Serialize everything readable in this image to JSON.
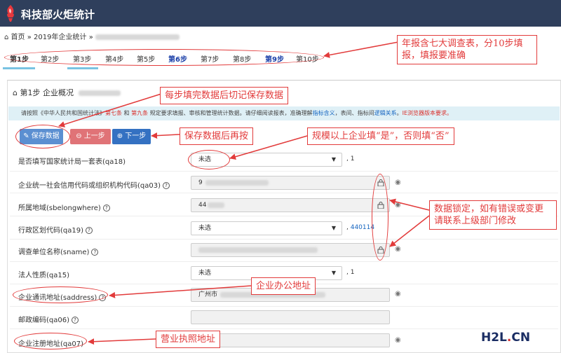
{
  "app": {
    "title": "科技部火炬统计"
  },
  "breadcrumb": {
    "home": "首页",
    "separator": "»",
    "current": "2019年企业统计"
  },
  "steps": [
    "第1步",
    "第2步",
    "第3步",
    "第4步",
    "第5步",
    "第6步",
    "第7步",
    "第8步",
    "第9步",
    "第10步"
  ],
  "section": {
    "title": "第1步 企业概况",
    "info": {
      "p1": "请按照《中华人民共和国统计法》",
      "law7": "第七条",
      "and": " 和 ",
      "law9": "第九条",
      "p2": " 规定要求填报、审核和管理统计数据。请仔细阅读报表，准确理解",
      "link1": "指标含义",
      "p3": "，表间、指标间",
      "link2": "逻辑关系",
      "p4": "。",
      "warn": "IE浏览器版本要求。"
    }
  },
  "buttons": {
    "save": "保存数据",
    "prev": "上一步",
    "next": "下一步"
  },
  "form": {
    "q18": {
      "label": "是否填写国家统计局一套表(qa18)",
      "value": "未选",
      "suffix": ", 1"
    },
    "q03": {
      "label": "企业统一社会信用代码或组织机构代码(qa03)",
      "value": "9"
    },
    "belong": {
      "label": "所属地域(sbelongwhere)",
      "value": "44"
    },
    "q19": {
      "label": "行政区划代码(qa19)",
      "value": "未选",
      "suffix": ", ",
      "code": "440114"
    },
    "sname": {
      "label": "调查单位名称(sname)",
      "value": ""
    },
    "q15": {
      "label": "法人性质(qa15)",
      "value": "未选",
      "suffix": ", 1"
    },
    "saddress": {
      "label": "企业通讯地址(saddress)",
      "value": "广州市"
    },
    "q06": {
      "label": "邮政编码(qa06)",
      "value": ""
    },
    "q07": {
      "label": "企业注册地址(qa07)",
      "value": ""
    }
  },
  "annotations": {
    "steps_note": "年报含七大调查表，分10步填报，填报要准确",
    "save_note": "每步填完数据后切记保存数据",
    "next_note": "保存数据后再按",
    "yes_note": "规模以上企业填“是”，否则填“否”",
    "lock_note": "数据锁定，如有错误或变更请联系上级部门修改",
    "office_note": "企业办公地址",
    "license_note": "营业执照地址"
  },
  "watermark": {
    "main": "H2L",
    "dot": ".",
    "tld": "CN"
  },
  "colors": {
    "topbar": "#2f3f5c",
    "annotation": "#e23b3b",
    "save": "#5b8fd1",
    "prev": "#e07377",
    "next": "#3471c2",
    "info_bg": "#dff0f6"
  }
}
